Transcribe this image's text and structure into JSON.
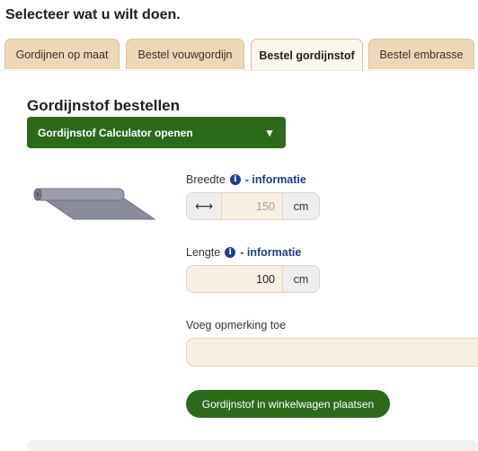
{
  "heading": "Selecteer wat u wilt doen.",
  "tabs": [
    {
      "label": "Gordijnen op maat"
    },
    {
      "label": "Bestel vouwgordijn"
    },
    {
      "label": "Bestel gordijnstof"
    },
    {
      "label": "Bestel embrasse"
    }
  ],
  "active_tab": "Bestel gordijnstof",
  "section": {
    "title": "Gordijnstof bestellen",
    "calculator_label": "Gordijnstof Calculator openen",
    "calculator_caret": "▼"
  },
  "width_field": {
    "label": "Breedte",
    "info_icon": "i",
    "info_link": "- informatie",
    "prefix_icon": "⟷",
    "placeholder": "150",
    "value": "",
    "unit": "cm"
  },
  "length_field": {
    "label": "Lengte",
    "info_icon": "i",
    "info_link": "- informatie",
    "value": "100",
    "unit": "cm"
  },
  "remark": {
    "label": "Voeg opmerking toe",
    "value": ""
  },
  "cart_button": "Gordijnstof in winkelwagen plaatsen",
  "colors": {
    "accent_green": "#2c6a1a",
    "tab_bg": "#ecd7b6",
    "info_blue": "#1e3f8c",
    "field_bg": "#f7efe3"
  }
}
